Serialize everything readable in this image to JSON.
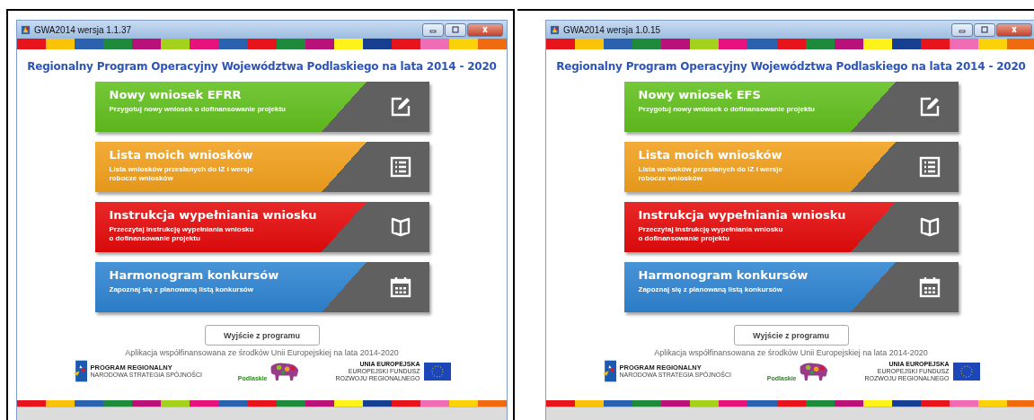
{
  "windows": [
    {
      "title": "GWA2014 wersja 1.1.37",
      "heading": "Regionalny Program Operacyjny Województwa Podlaskiego na lata 2014 - 2020",
      "tiles": [
        {
          "kind": "edit",
          "color": "#62c01e",
          "title": "Nowy wniosek EFRR",
          "description": [
            "Przygotuj nowy wniosek o dofinansowanie projektu"
          ]
        },
        {
          "kind": "list",
          "color": "#f2a01c",
          "title": "Lista moich wniosków",
          "description": [
            "Lista wniosków przesłanych do IZ i wersje",
            "robocze wniosków"
          ]
        },
        {
          "kind": "book",
          "color": "#e50b0b",
          "title": "Instrukcja wypełniania wniosku",
          "description": [
            "Przeczytaj instrukcję wypełniania wniosku",
            "o dofinansowanie projektu"
          ]
        },
        {
          "kind": "calendar",
          "color": "#2e84d2",
          "title": "Harmonogram konkursów",
          "description": [
            "Zapoznaj się z planowaną listą konkursów"
          ]
        }
      ],
      "exit_button": "Wyjście z programu",
      "funding_note": "Aplikacja współfinansowana ze środków Unii Europejskiej na lata 2014-2020",
      "logos": {
        "program_title": "PROGRAM REGIONALNY",
        "program_subtitle": "NARODOWA STRATEGIA SPÓJNOŚCI",
        "region": "Podlaskie",
        "eu_lines": [
          "UNIA EUROPEJSKA",
          "EUROPEJSKI FUNDUSZ",
          "ROZWOJU REGIONALNEGO"
        ]
      }
    },
    {
      "title": "GWA2014 wersja 1.0.15",
      "heading": "Regionalny Program Operacyjny Województwa Podlaskiego na lata 2014 - 2020",
      "tiles": [
        {
          "kind": "edit",
          "color": "#62c01e",
          "title": "Nowy wniosek EFS",
          "description": [
            "Przygotuj nowy wniosek o dofinansowanie projektu"
          ]
        },
        {
          "kind": "list",
          "color": "#f2a01c",
          "title": "Lista moich wniosków",
          "description": [
            "Lista wniosków przesłanych do IZ i wersje",
            "robocze wniosków"
          ]
        },
        {
          "kind": "book",
          "color": "#e50b0b",
          "title": "Instrukcja wypełniania wniosku",
          "description": [
            "Przeczytaj instrukcję wypełniania wniosku",
            "o dofinansowanie projektu"
          ]
        },
        {
          "kind": "calendar",
          "color": "#2e84d2",
          "title": "Harmonogram konkursów",
          "description": [
            "Zapoznaj się z planowaną listą konkursów"
          ]
        }
      ],
      "exit_button": "Wyjście z programu",
      "funding_note": "Aplikacja współfinansowana ze środków Unii Europejskiej na lata 2014-2020",
      "logos": {
        "program_title": "PROGRAM REGIONALNY",
        "program_subtitle": "NARODOWA STRATEGIA SPÓJNOŚCI",
        "region": "Podlaskie",
        "eu_lines": [
          "UNIA EUROPEJSKA",
          "EUROPEJSKI FUNDUSZ",
          "ROZWOJU REGIONALNEGO"
        ]
      }
    }
  ]
}
